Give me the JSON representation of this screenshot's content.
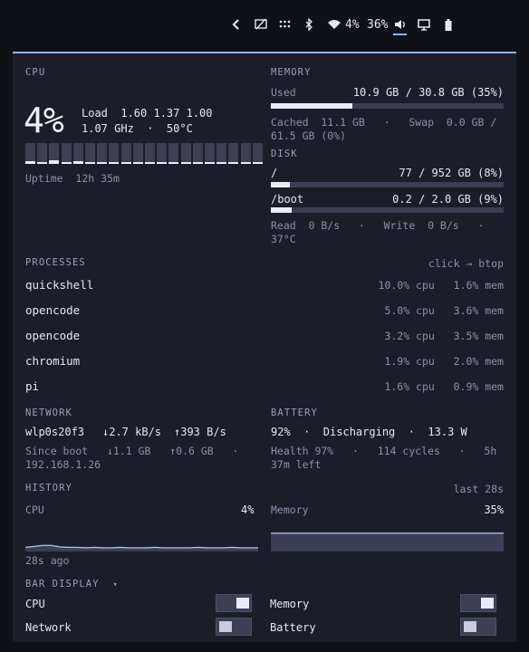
{
  "topbar": {
    "wifi_percent": "4%",
    "battery_percent": "36%",
    "icons": [
      "chevron-left-icon",
      "screen-off-icon",
      "grid-dots-icon",
      "bluetooth-icon",
      "wifi-icon",
      "volume-icon",
      "monitor-icon",
      "battery-icon"
    ]
  },
  "cpu": {
    "title": "CPU",
    "percent": "4%",
    "load_label": "Load",
    "load_values": "1.60 1.37 1.00",
    "freq_temp": "1.07 GHz  ·  50°C",
    "uptime_label": "Uptime",
    "uptime_value": "12h 35m",
    "core_levels": [
      0.12,
      0.1,
      0.18,
      0.08,
      0.12,
      0.1,
      0.08,
      0.1,
      0.08,
      0.1,
      0.08,
      0.1,
      0.08,
      0.08,
      0.1,
      0.08,
      0.08,
      0.1,
      0.08,
      0.08
    ]
  },
  "memory": {
    "title": "MEMORY",
    "used_label": "Used",
    "used_value": "10.9 GB / 30.8 GB (35%)",
    "used_fraction": 0.35,
    "cached_line1": "Cached  11.1 GB   ·   Swap  0.0 GB /",
    "cached_line2": "61.5 GB (0%)"
  },
  "disk": {
    "title": "DISK",
    "root_label": "/",
    "root_value": "77 / 952 GB (8%)",
    "root_fraction": 0.08,
    "boot_label": "/boot",
    "boot_value": "0.2 / 2.0 GB (9%)",
    "boot_fraction": 0.09,
    "io_line1": "Read  0 B/s   ·   Write  0 B/s   ·",
    "io_line2": "37°C"
  },
  "processes": {
    "title": "PROCESSES",
    "hint": "click → btop",
    "rows": [
      {
        "name": "quickshell",
        "stat": "10.0% cpu   1.6% mem"
      },
      {
        "name": "opencode",
        "stat": "5.0% cpu   3.6% mem"
      },
      {
        "name": "opencode",
        "stat": "3.2% cpu   3.5% mem"
      },
      {
        "name": "chromium",
        "stat": "1.9% cpu   2.0% mem"
      },
      {
        "name": "pi",
        "stat": "1.6% cpu   0.9% mem"
      }
    ]
  },
  "network": {
    "title": "NETWORK",
    "iface": "wlp0s20f3",
    "down": "↓2.7 kB/s",
    "up": "↑393 B/s",
    "since_line1": "Since boot   ↓1.1 GB   ↑0.6 GB   ·",
    "since_line2": "192.168.1.26"
  },
  "battery": {
    "title": "BATTERY",
    "status": "92%  ·  Discharging  ·  13.3 W",
    "health_line1": "Health 97%   ·   114 cycles   ·   5h",
    "health_line2": "37m left"
  },
  "history": {
    "title": "HISTORY",
    "range": "last 28s",
    "cpu_label": "CPU",
    "cpu_value": "4%",
    "mem_label": "Memory",
    "mem_value": "35%",
    "time_label": "28s ago",
    "cpu_series": [
      5,
      7,
      9,
      9,
      6,
      5,
      5,
      4,
      5,
      4,
      4,
      5,
      4,
      4,
      4,
      5,
      4,
      4,
      4,
      4,
      5,
      4,
      4,
      4,
      5,
      4,
      4,
      4
    ],
    "mem_series": [
      35,
      35,
      35,
      35,
      35,
      35,
      35,
      35,
      35,
      35,
      35,
      35,
      35,
      35,
      35,
      35,
      35,
      35,
      35,
      35,
      35,
      35,
      35,
      35,
      35,
      35,
      35,
      35
    ]
  },
  "bar_display": {
    "title": "BAR DISPLAY",
    "chevron": "▾",
    "items": [
      {
        "label": "CPU",
        "on": true
      },
      {
        "label": "Memory",
        "on": true
      },
      {
        "label": "Network",
        "on": false
      },
      {
        "label": "Battery",
        "on": false
      }
    ]
  }
}
